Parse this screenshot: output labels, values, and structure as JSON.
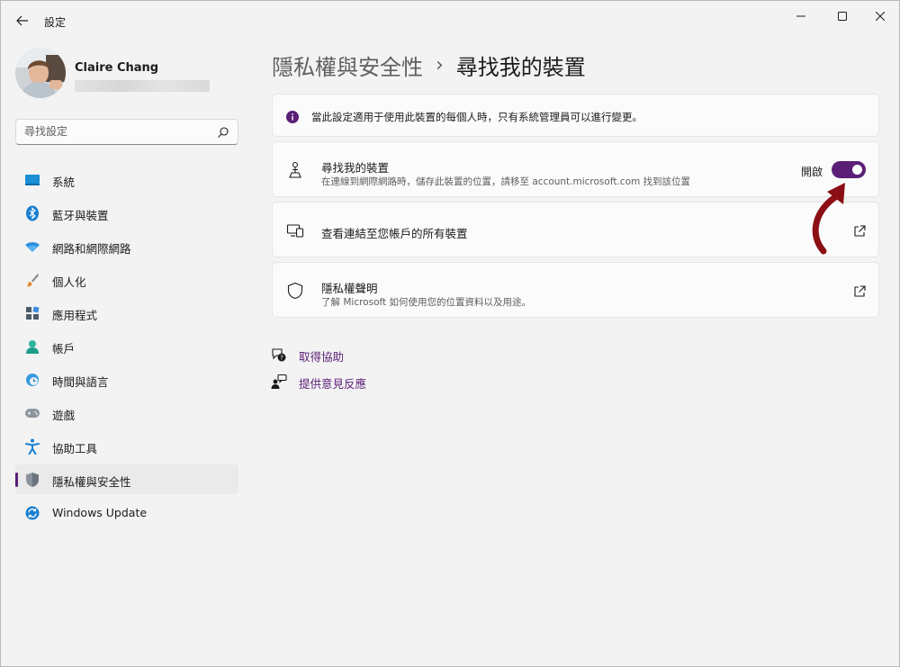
{
  "window": {
    "title": "設定"
  },
  "profile": {
    "name": "Claire Chang"
  },
  "search": {
    "placeholder": "尋找設定"
  },
  "sidebar": {
    "items": [
      {
        "label": "系統",
        "icon": "system-icon"
      },
      {
        "label": "藍牙與裝置",
        "icon": "bluetooth-icon"
      },
      {
        "label": "網路和網際網路",
        "icon": "wifi-icon"
      },
      {
        "label": "個人化",
        "icon": "brush-icon"
      },
      {
        "label": "應用程式",
        "icon": "apps-icon"
      },
      {
        "label": "帳戶",
        "icon": "account-icon"
      },
      {
        "label": "時間與語言",
        "icon": "time-language-icon"
      },
      {
        "label": "遊戲",
        "icon": "gamepad-icon"
      },
      {
        "label": "協助工具",
        "icon": "accessibility-icon"
      },
      {
        "label": "隱私權與安全性",
        "icon": "shield-icon",
        "active": true
      },
      {
        "label": "Windows Update",
        "icon": "windows-update-icon"
      }
    ]
  },
  "breadcrumb": {
    "parent": "隱私權與安全性",
    "separator": "›",
    "current": "尋找我的裝置"
  },
  "info_banner": {
    "text": "當此設定適用于使用此裝置的每個人時，只有系統管理員可以進行變更。"
  },
  "find_device": {
    "title": "尋找我的裝置",
    "description": "在連線到網際網路時，儲存此裝置的位置，請移至 account.microsoft.com 找到該位置",
    "toggle_label": "開啟",
    "toggle_on": true
  },
  "linked_devices": {
    "title": "查看連結至您帳戶的所有裝置"
  },
  "privacy_statement": {
    "title": "隱私權聲明",
    "description": "了解 Microsoft 如何使用您的位置資料以及用途。"
  },
  "help": {
    "get_help": "取得協助",
    "feedback": "提供意見反應"
  },
  "colors": {
    "accent": "#5b1f76",
    "annotation_arrow": "#8b0f14"
  }
}
